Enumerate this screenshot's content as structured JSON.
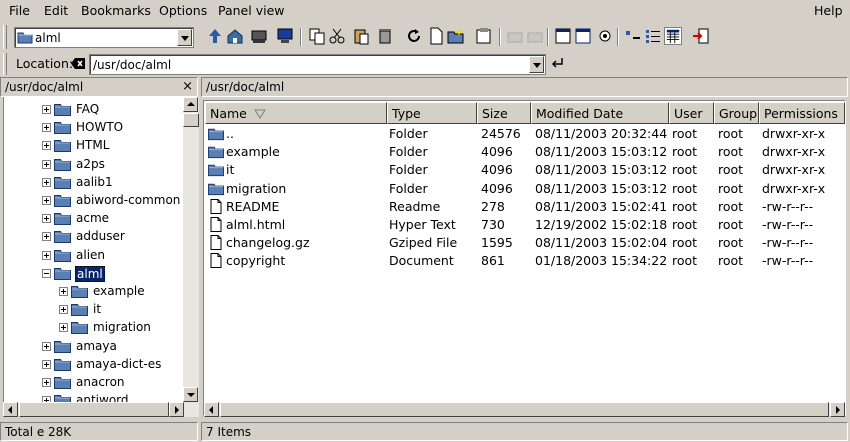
{
  "menu": [
    "File",
    "Edit",
    "Bookmarks",
    "Options",
    "Panel view"
  ],
  "menu_help": "Help",
  "toolbar": {
    "path_combo": "alml",
    "icons": [
      "up-arrow-icon",
      "home-icon",
      "drive-icon",
      "computer-icon",
      "copy-icon",
      "cut-icon",
      "paste-icon",
      "trash-icon",
      "refresh-icon",
      "new-file-icon",
      "new-folder-icon",
      "properties-icon",
      "back-icon",
      "forward-icon",
      "window-icon",
      "tree-view-icon",
      "settings-icon",
      "icon-view-icon",
      "list-view-icon",
      "detail-view-icon",
      "exit-icon"
    ]
  },
  "location": {
    "label": "Location:",
    "value": "/usr/doc/alml"
  },
  "tree_panel": {
    "header": "/usr/doc/alml",
    "close": "×",
    "items": [
      {
        "label": "FAQ",
        "level": 0,
        "expanded": false
      },
      {
        "label": "HOWTO",
        "level": 0,
        "expanded": false
      },
      {
        "label": "HTML",
        "level": 0,
        "expanded": false
      },
      {
        "label": "a2ps",
        "level": 0,
        "expanded": false
      },
      {
        "label": "aalib1",
        "level": 0,
        "expanded": false
      },
      {
        "label": "abiword-common",
        "level": 0,
        "expanded": false
      },
      {
        "label": "acme",
        "level": 0,
        "expanded": false
      },
      {
        "label": "adduser",
        "level": 0,
        "expanded": false
      },
      {
        "label": "alien",
        "level": 0,
        "expanded": false
      },
      {
        "label": "alml",
        "level": 0,
        "expanded": true,
        "selected": true
      },
      {
        "label": "example",
        "level": 1,
        "expanded": false
      },
      {
        "label": "it",
        "level": 1,
        "expanded": false
      },
      {
        "label": "migration",
        "level": 1,
        "expanded": false
      },
      {
        "label": "amaya",
        "level": 0,
        "expanded": false
      },
      {
        "label": "amaya-dict-es",
        "level": 0,
        "expanded": false
      },
      {
        "label": "anacron",
        "level": 0,
        "expanded": false
      },
      {
        "label": "antiword",
        "level": 0,
        "expanded": false
      }
    ]
  },
  "file_panel": {
    "header": "/usr/doc/alml",
    "columns": [
      "Name",
      "Type",
      "Size",
      "Modified Date",
      "User",
      "Group",
      "Permissions"
    ],
    "rows": [
      {
        "name": "..",
        "type": "Folder",
        "size": "24576",
        "date": "08/11/2003 20:32:44",
        "user": "root",
        "group": "root",
        "perm": "drwxr-xr-x",
        "icon": "folder-icon"
      },
      {
        "name": "example",
        "type": "Folder",
        "size": "4096",
        "date": "08/11/2003 15:03:12",
        "user": "root",
        "group": "root",
        "perm": "drwxr-xr-x",
        "icon": "folder-icon"
      },
      {
        "name": "it",
        "type": "Folder",
        "size": "4096",
        "date": "08/11/2003 15:03:12",
        "user": "root",
        "group": "root",
        "perm": "drwxr-xr-x",
        "icon": "folder-icon"
      },
      {
        "name": "migration",
        "type": "Folder",
        "size": "4096",
        "date": "08/11/2003 15:03:12",
        "user": "root",
        "group": "root",
        "perm": "drwxr-xr-x",
        "icon": "folder-icon"
      },
      {
        "name": "README",
        "type": "Readme",
        "size": "278",
        "date": "08/11/2003 15:02:41",
        "user": "root",
        "group": "root",
        "perm": "-rw-r--r--",
        "icon": "document-icon"
      },
      {
        "name": "alml.html",
        "type": "Hyper Text",
        "size": "730",
        "date": "12/19/2002 15:02:18",
        "user": "root",
        "group": "root",
        "perm": "-rw-r--r--",
        "icon": "document-icon"
      },
      {
        "name": "changelog.gz",
        "type": "Gziped File",
        "size": "1595",
        "date": "08/11/2003 15:02:04",
        "user": "root",
        "group": "root",
        "perm": "-rw-r--r--",
        "icon": "document-icon"
      },
      {
        "name": "copyright",
        "type": "Document",
        "size": "861",
        "date": "01/18/2003 15:34:22",
        "user": "root",
        "group": "root",
        "perm": "-rw-r--r--",
        "icon": "document-icon"
      }
    ]
  },
  "status": {
    "left": "Total e 28K",
    "right": "7 Items"
  },
  "colors": {
    "folder": "#5a7fb5",
    "selection": "#0a246a",
    "background": "#d4d0c8"
  }
}
